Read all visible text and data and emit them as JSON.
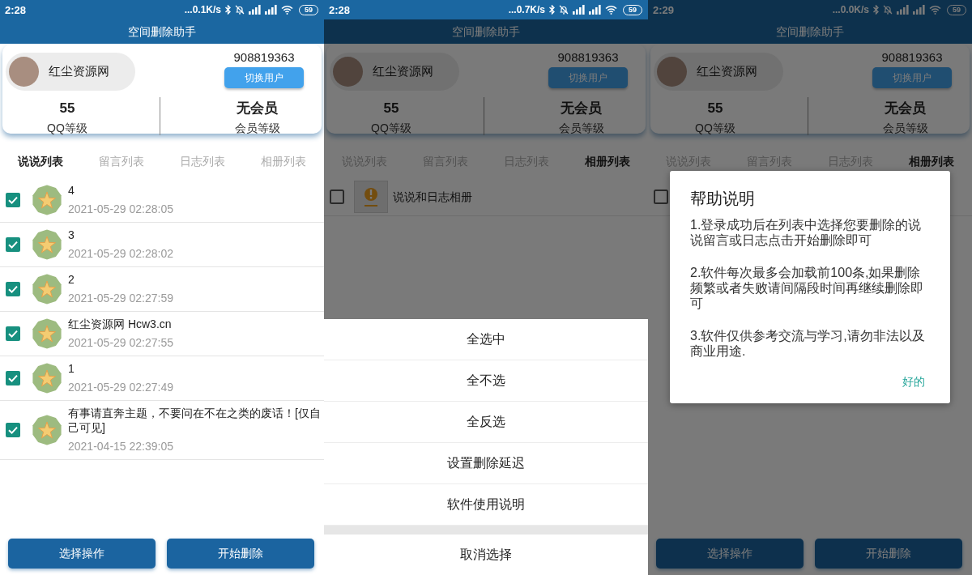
{
  "screens": [
    {
      "status_bar": {
        "time": "2:28",
        "network_speed": "...0.1K/s",
        "battery": "59"
      },
      "title": "空间删除助手",
      "profile": {
        "name": "红尘资源网",
        "account": "908819363",
        "switch_button": "切换用户",
        "stats": [
          {
            "value": "55",
            "label": "QQ等级"
          },
          {
            "value": "无会员",
            "label": "会员等级"
          }
        ]
      },
      "tabs": [
        {
          "label": "说说列表",
          "selected": true
        },
        {
          "label": "留言列表",
          "selected": false
        },
        {
          "label": "日志列表",
          "selected": false
        },
        {
          "label": "相册列表",
          "selected": false
        }
      ],
      "list": [
        {
          "kind": "post",
          "checked": true,
          "text": "4",
          "time": "2021-05-29 02:28:05"
        },
        {
          "kind": "post",
          "checked": true,
          "text": "3",
          "time": "2021-05-29 02:28:02"
        },
        {
          "kind": "post",
          "checked": true,
          "text": "2",
          "time": "2021-05-29 02:27:59"
        },
        {
          "kind": "post",
          "checked": true,
          "text": "红尘资源网 Hcw3.cn",
          "time": "2021-05-29 02:27:55"
        },
        {
          "kind": "post",
          "checked": true,
          "text": "1",
          "time": "2021-05-29 02:27:49"
        },
        {
          "kind": "post",
          "checked": true,
          "text": "有事请直奔主题，不要问在不在之类的废话！[仅自己可见]",
          "time": "2021-04-15 22:39:05"
        }
      ],
      "buttons": [
        "选择操作",
        "开始删除"
      ]
    },
    {
      "status_bar": {
        "time": "2:28",
        "network_speed": "...0.7K/s",
        "battery": "59"
      },
      "title": "空间删除助手",
      "profile": {
        "name": "红尘资源网",
        "account": "908819363",
        "switch_button": "切换用户",
        "stats": [
          {
            "value": "55",
            "label": "QQ等级"
          },
          {
            "value": "无会员",
            "label": "会员等级"
          }
        ]
      },
      "tabs": [
        {
          "label": "说说列表",
          "selected": false
        },
        {
          "label": "留言列表",
          "selected": false
        },
        {
          "label": "日志列表",
          "selected": false
        },
        {
          "label": "相册列表",
          "selected": true
        }
      ],
      "list": [
        {
          "kind": "album",
          "checked": false,
          "thumbnail": true,
          "text": "说说和日志相册"
        }
      ],
      "overlay": {
        "kind": "action_sheet",
        "items": [
          "全选中",
          "全不选",
          "全反选",
          "设置删除延迟",
          "软件使用说明"
        ],
        "cancel": "取消选择"
      }
    },
    {
      "status_bar": {
        "time": "2:29",
        "network_speed": "...0.0K/s",
        "battery": "59"
      },
      "title": "空间删除助手",
      "profile": {
        "name": "红尘资源网",
        "account": "908819363",
        "switch_button": "切换用户",
        "stats": [
          {
            "value": "55",
            "label": "QQ等级"
          },
          {
            "value": "无会员",
            "label": "会员等级"
          }
        ]
      },
      "tabs": [
        {
          "label": "说说列表",
          "selected": false
        },
        {
          "label": "留言列表",
          "selected": false
        },
        {
          "label": "日志列表",
          "selected": false
        },
        {
          "label": "相册列表",
          "selected": true
        }
      ],
      "list": [
        {
          "kind": "album",
          "checked": false
        }
      ],
      "buttons": [
        "选择操作",
        "开始删除"
      ],
      "overlay": {
        "kind": "dialog",
        "title": "帮助说明",
        "paragraphs": [
          "1.登录成功后在列表中选择您要删除的说说留言或日志点击开始删除即可",
          "2.软件每次最多会加载前100条,如果删除频繁或者失败请间隔段时间再继续删除即可",
          "3.软件仅供参考交流与学习,请勿非法以及商业用途."
        ],
        "button": "好的"
      }
    }
  ]
}
